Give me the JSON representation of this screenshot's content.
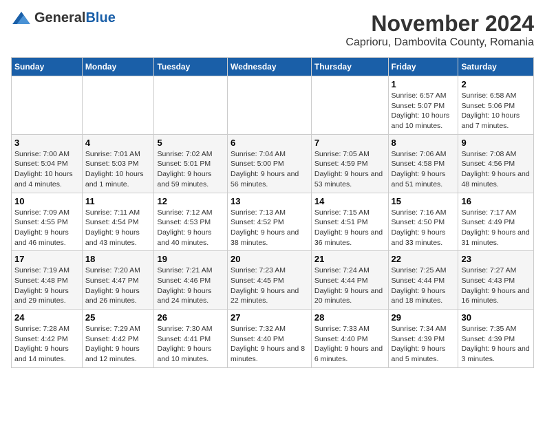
{
  "logo": {
    "general": "General",
    "blue": "Blue"
  },
  "title": "November 2024",
  "location": "Caprioru, Dambovita County, Romania",
  "days_header": [
    "Sunday",
    "Monday",
    "Tuesday",
    "Wednesday",
    "Thursday",
    "Friday",
    "Saturday"
  ],
  "weeks": [
    [
      {
        "day": "",
        "info": ""
      },
      {
        "day": "",
        "info": ""
      },
      {
        "day": "",
        "info": ""
      },
      {
        "day": "",
        "info": ""
      },
      {
        "day": "",
        "info": ""
      },
      {
        "day": "1",
        "info": "Sunrise: 6:57 AM\nSunset: 5:07 PM\nDaylight: 10 hours and 10 minutes."
      },
      {
        "day": "2",
        "info": "Sunrise: 6:58 AM\nSunset: 5:06 PM\nDaylight: 10 hours and 7 minutes."
      }
    ],
    [
      {
        "day": "3",
        "info": "Sunrise: 7:00 AM\nSunset: 5:04 PM\nDaylight: 10 hours and 4 minutes."
      },
      {
        "day": "4",
        "info": "Sunrise: 7:01 AM\nSunset: 5:03 PM\nDaylight: 10 hours and 1 minute."
      },
      {
        "day": "5",
        "info": "Sunrise: 7:02 AM\nSunset: 5:01 PM\nDaylight: 9 hours and 59 minutes."
      },
      {
        "day": "6",
        "info": "Sunrise: 7:04 AM\nSunset: 5:00 PM\nDaylight: 9 hours and 56 minutes."
      },
      {
        "day": "7",
        "info": "Sunrise: 7:05 AM\nSunset: 4:59 PM\nDaylight: 9 hours and 53 minutes."
      },
      {
        "day": "8",
        "info": "Sunrise: 7:06 AM\nSunset: 4:58 PM\nDaylight: 9 hours and 51 minutes."
      },
      {
        "day": "9",
        "info": "Sunrise: 7:08 AM\nSunset: 4:56 PM\nDaylight: 9 hours and 48 minutes."
      }
    ],
    [
      {
        "day": "10",
        "info": "Sunrise: 7:09 AM\nSunset: 4:55 PM\nDaylight: 9 hours and 46 minutes."
      },
      {
        "day": "11",
        "info": "Sunrise: 7:11 AM\nSunset: 4:54 PM\nDaylight: 9 hours and 43 minutes."
      },
      {
        "day": "12",
        "info": "Sunrise: 7:12 AM\nSunset: 4:53 PM\nDaylight: 9 hours and 40 minutes."
      },
      {
        "day": "13",
        "info": "Sunrise: 7:13 AM\nSunset: 4:52 PM\nDaylight: 9 hours and 38 minutes."
      },
      {
        "day": "14",
        "info": "Sunrise: 7:15 AM\nSunset: 4:51 PM\nDaylight: 9 hours and 36 minutes."
      },
      {
        "day": "15",
        "info": "Sunrise: 7:16 AM\nSunset: 4:50 PM\nDaylight: 9 hours and 33 minutes."
      },
      {
        "day": "16",
        "info": "Sunrise: 7:17 AM\nSunset: 4:49 PM\nDaylight: 9 hours and 31 minutes."
      }
    ],
    [
      {
        "day": "17",
        "info": "Sunrise: 7:19 AM\nSunset: 4:48 PM\nDaylight: 9 hours and 29 minutes."
      },
      {
        "day": "18",
        "info": "Sunrise: 7:20 AM\nSunset: 4:47 PM\nDaylight: 9 hours and 26 minutes."
      },
      {
        "day": "19",
        "info": "Sunrise: 7:21 AM\nSunset: 4:46 PM\nDaylight: 9 hours and 24 minutes."
      },
      {
        "day": "20",
        "info": "Sunrise: 7:23 AM\nSunset: 4:45 PM\nDaylight: 9 hours and 22 minutes."
      },
      {
        "day": "21",
        "info": "Sunrise: 7:24 AM\nSunset: 4:44 PM\nDaylight: 9 hours and 20 minutes."
      },
      {
        "day": "22",
        "info": "Sunrise: 7:25 AM\nSunset: 4:44 PM\nDaylight: 9 hours and 18 minutes."
      },
      {
        "day": "23",
        "info": "Sunrise: 7:27 AM\nSunset: 4:43 PM\nDaylight: 9 hours and 16 minutes."
      }
    ],
    [
      {
        "day": "24",
        "info": "Sunrise: 7:28 AM\nSunset: 4:42 PM\nDaylight: 9 hours and 14 minutes."
      },
      {
        "day": "25",
        "info": "Sunrise: 7:29 AM\nSunset: 4:42 PM\nDaylight: 9 hours and 12 minutes."
      },
      {
        "day": "26",
        "info": "Sunrise: 7:30 AM\nSunset: 4:41 PM\nDaylight: 9 hours and 10 minutes."
      },
      {
        "day": "27",
        "info": "Sunrise: 7:32 AM\nSunset: 4:40 PM\nDaylight: 9 hours and 8 minutes."
      },
      {
        "day": "28",
        "info": "Sunrise: 7:33 AM\nSunset: 4:40 PM\nDaylight: 9 hours and 6 minutes."
      },
      {
        "day": "29",
        "info": "Sunrise: 7:34 AM\nSunset: 4:39 PM\nDaylight: 9 hours and 5 minutes."
      },
      {
        "day": "30",
        "info": "Sunrise: 7:35 AM\nSunset: 4:39 PM\nDaylight: 9 hours and 3 minutes."
      }
    ]
  ]
}
